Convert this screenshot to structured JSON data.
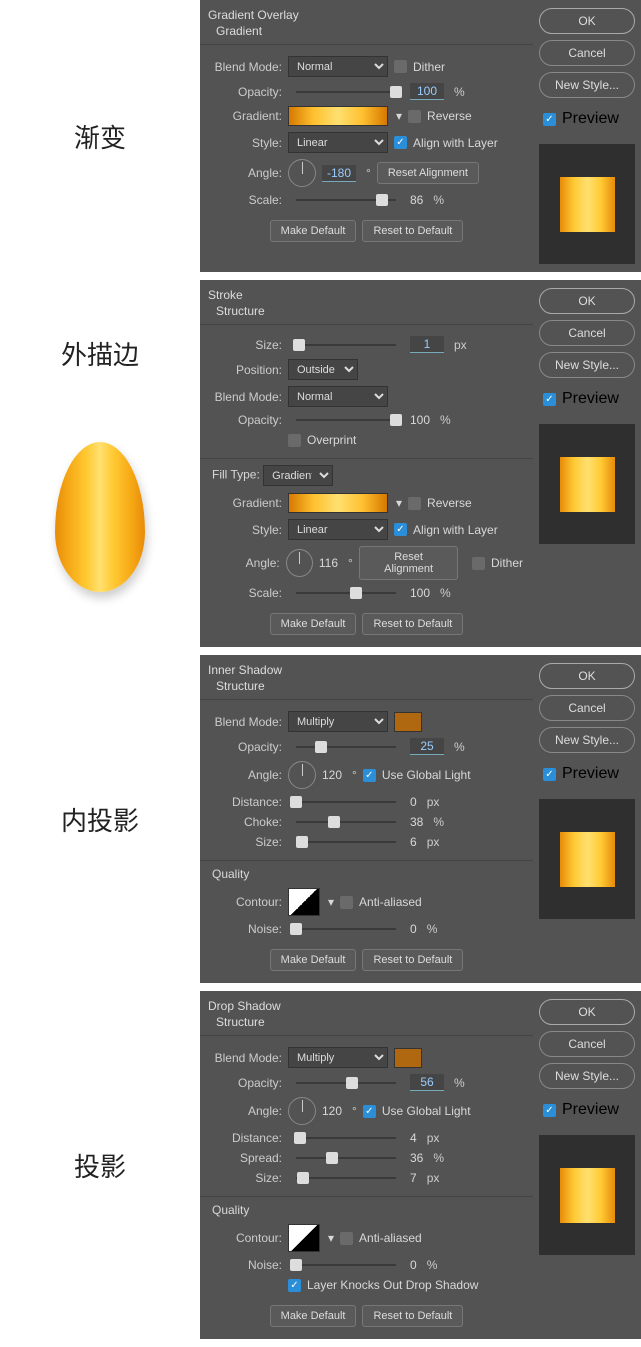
{
  "labels": {
    "gradient": "渐变",
    "stroke": "外描边",
    "inner": "内投影",
    "drop": "投影"
  },
  "common": {
    "ok": "OK",
    "cancel": "Cancel",
    "newstyle": "New Style...",
    "preview": "Preview",
    "makedef": "Make Default",
    "resetdef": "Reset to Default",
    "resetalign": "Reset Alignment",
    "blendmode": "Blend Mode:",
    "opacity": "Opacity:",
    "angle": "Angle:",
    "scale": "Scale:",
    "style": "Style:",
    "gradient": "Gradient:",
    "reverse": "Reverse",
    "align": "Align with Layer",
    "dither": "Dither",
    "linear": "Linear",
    "normal": "Normal",
    "multiply": "Multiply",
    "pct": "%",
    "px": "px",
    "deg": "°"
  },
  "p1": {
    "title": "Gradient Overlay",
    "sub": "Gradient",
    "opacity": "100",
    "angle": "-180",
    "scale": "86"
  },
  "p2": {
    "title": "Stroke",
    "sub": "Structure",
    "size": "Size:",
    "sizeval": "1",
    "position": "Position:",
    "outside": "Outside",
    "opacity": "100",
    "overprint": "Overprint",
    "filltype": "Fill Type:",
    "gradientft": "Gradient",
    "angle": "116",
    "scale": "100"
  },
  "p3": {
    "title": "Inner Shadow",
    "sub": "Structure",
    "opacity": "25",
    "angle": "120",
    "ugl": "Use Global Light",
    "distance": "Distance:",
    "distval": "0",
    "choke": "Choke:",
    "chokeval": "38",
    "size": "Size:",
    "sizeval": "6",
    "quality": "Quality",
    "contour": "Contour:",
    "anti": "Anti-aliased",
    "noise": "Noise:",
    "noiseval": "0"
  },
  "p4": {
    "title": "Drop Shadow",
    "sub": "Structure",
    "opacity": "56",
    "angle": "120",
    "ugl": "Use Global Light",
    "distance": "Distance:",
    "distval": "4",
    "spread": "Spread:",
    "spreadval": "36",
    "size": "Size:",
    "sizeval": "7",
    "quality": "Quality",
    "contour": "Contour:",
    "anti": "Anti-aliased",
    "noise": "Noise:",
    "noiseval": "0",
    "knocks": "Layer Knocks Out Drop Shadow"
  }
}
